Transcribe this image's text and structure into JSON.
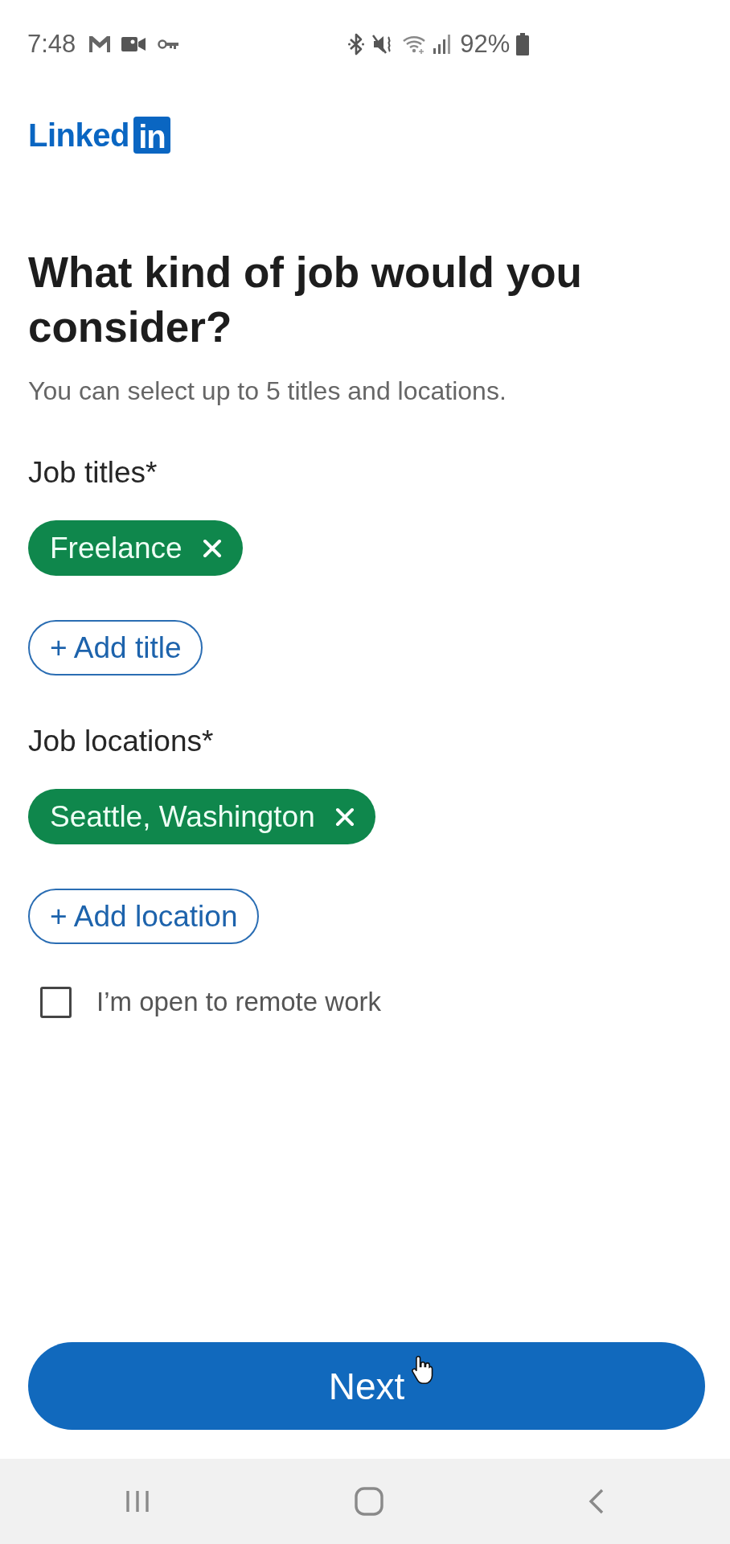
{
  "status_bar": {
    "time": "7:48",
    "battery": "92%"
  },
  "logo": {
    "text": "Linked",
    "badge": "in"
  },
  "heading": "What kind of job would you consider?",
  "subtitle": "You can select up to 5 titles and locations.",
  "sections": [
    {
      "label": "Job titles*",
      "chips": [
        {
          "label": "Freelance"
        }
      ],
      "add_button": "+ Add title"
    },
    {
      "label": "Job locations*",
      "chips": [
        {
          "label": "Seattle, Washington"
        }
      ],
      "add_button": "+ Add location"
    }
  ],
  "remote_checkbox": {
    "label": "I’m open to remote work",
    "checked": false
  },
  "next_button": "Next"
}
